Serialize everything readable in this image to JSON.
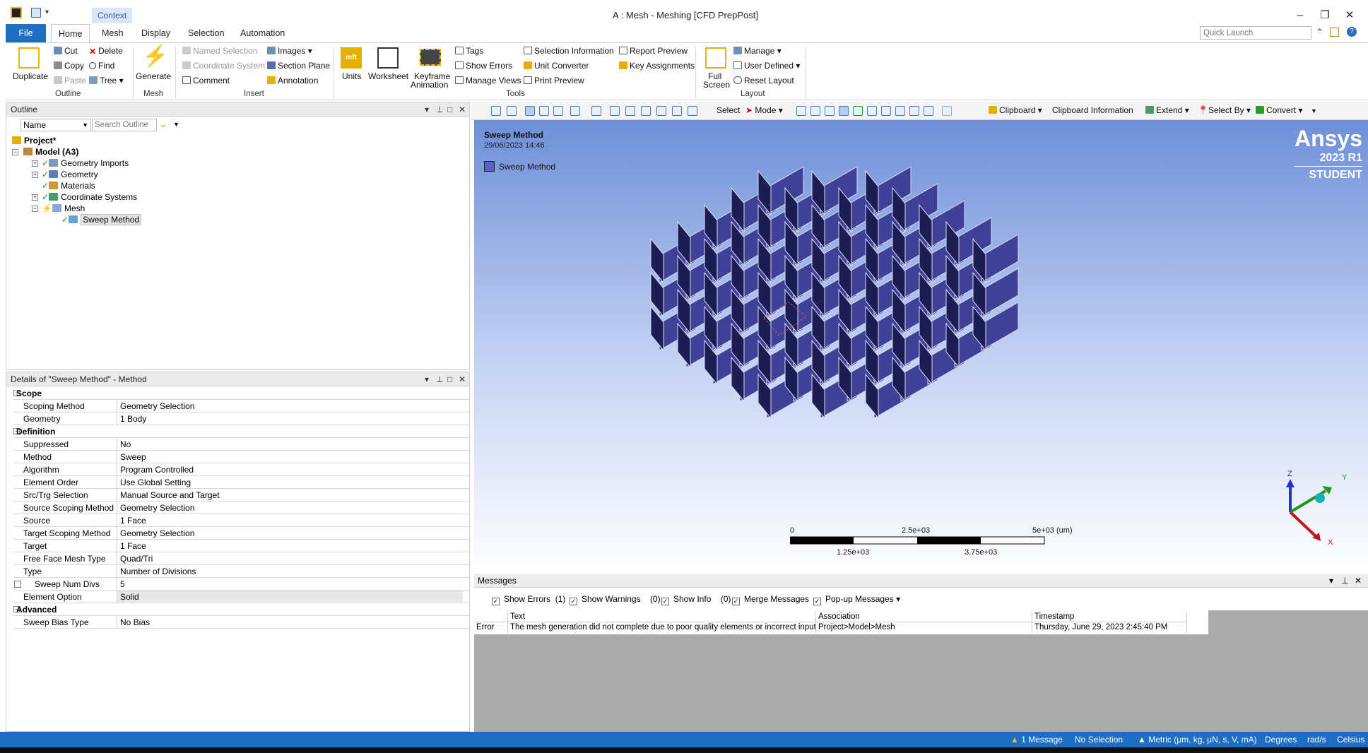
{
  "window": {
    "title": "A : Mesh - Meshing [CFD PrepPost]",
    "context_tab": "Context",
    "quick_launch_placeholder": "Quick Launch"
  },
  "ribbon_tabs": [
    "File",
    "Home",
    "Mesh",
    "Display",
    "Selection",
    "Automation"
  ],
  "ribbon": {
    "outline": {
      "group": "Outline",
      "duplicate": "Duplicate",
      "cut": "Cut",
      "copy": "Copy",
      "paste": "Paste",
      "delete": "Delete",
      "find": "Find",
      "tree": "Tree"
    },
    "mesh": {
      "group": "Mesh",
      "generate": "Generate"
    },
    "insert": {
      "group": "Insert",
      "named_selection": "Named Selection",
      "coordinate_system": "Coordinate System",
      "comment": "Comment",
      "images": "Images",
      "section_plane": "Section Plane",
      "annotation": "Annotation"
    },
    "tools": {
      "group": "Tools",
      "units": "Units",
      "worksheet": "Worksheet",
      "keyframe_1": "Keyframe",
      "keyframe_2": "Animation",
      "tags": "Tags",
      "show_errors": "Show Errors",
      "manage_views": "Manage Views",
      "selection_information": "Selection Information",
      "unit_converter": "Unit Converter",
      "print_preview": "Print Preview",
      "report_preview": "Report Preview",
      "key_assignments": "Key Assignments"
    },
    "layout": {
      "group": "Layout",
      "full_1": "Full",
      "full_2": "Screen",
      "manage": "Manage",
      "user_defined": "User Defined",
      "reset_layout": "Reset Layout"
    }
  },
  "outline": {
    "title": "Outline",
    "name_dropdown": "Name",
    "search_placeholder": "Search Outline",
    "tree": {
      "project": "Project*",
      "model": "Model (A3)",
      "geometry_imports": "Geometry Imports",
      "geometry": "Geometry",
      "materials": "Materials",
      "coordinate_systems": "Coordinate Systems",
      "mesh": "Mesh",
      "sweep_method": "Sweep Method"
    }
  },
  "details": {
    "title": "Details of \"Sweep Method\" - Method",
    "rows": [
      {
        "k": "Scope",
        "cat": true
      },
      {
        "k": "Scoping Method",
        "v": "Geometry Selection"
      },
      {
        "k": "Geometry",
        "v": "1 Body"
      },
      {
        "k": "Definition",
        "cat": true
      },
      {
        "k": "Suppressed",
        "v": "No"
      },
      {
        "k": "Method",
        "v": "Sweep"
      },
      {
        "k": "Algorithm",
        "v": "Program Controlled"
      },
      {
        "k": "Element Order",
        "v": "Use Global Setting"
      },
      {
        "k": "Src/Trg Selection",
        "v": "Manual Source and Target"
      },
      {
        "k": "Source Scoping Method",
        "v": "Geometry Selection"
      },
      {
        "k": "Source",
        "v": "1 Face"
      },
      {
        "k": "Target Scoping Method",
        "v": "Geometry Selection"
      },
      {
        "k": "Target",
        "v": "1 Face"
      },
      {
        "k": "Free Face Mesh Type",
        "v": "Quad/Tri"
      },
      {
        "k": "Type",
        "v": "Number of Divisions"
      },
      {
        "k": "Sweep Num Divs",
        "v": "5",
        "check": true
      },
      {
        "k": "Element Option",
        "v": "Solid",
        "hl": true
      },
      {
        "k": "Advanced",
        "cat": true
      },
      {
        "k": "Sweep Bias Type",
        "v": "No Bias"
      }
    ]
  },
  "viewport_toolbar": {
    "select": "Select",
    "mode": "Mode",
    "clipboard": "Clipboard",
    "clipboard_information": "Clipboard Information",
    "extend": "Extend",
    "select_by": "Select By",
    "convert": "Convert"
  },
  "viewport": {
    "title": "Sweep Method",
    "date": "29/06/2023 14:46",
    "legend": "Sweep Method",
    "brand": "Ansys",
    "version": "2023 R1",
    "edition": "STUDENT",
    "scale": {
      "l0": "0",
      "l1": "2.5e+03",
      "l2": "5e+03 (um)",
      "l3": "1.25e+03",
      "l4": "3.75e+03"
    },
    "axes": {
      "z": "Z",
      "y": "Y",
      "x": "X"
    },
    "colors": {
      "face": "#3d3f8f",
      "edge": "#1c1d52"
    }
  },
  "messages": {
    "title": "Messages",
    "show_errors": "Show Errors",
    "errors_count": "(1)",
    "show_warnings": "Show Warnings",
    "warnings_count": "(0)",
    "show_info": "Show Info",
    "info_count": "(0)",
    "merge_messages": "Merge Messages",
    "popup_messages": "Pop-up Messages",
    "col_text": "Text",
    "col_association": "Association",
    "col_timestamp": "Timestamp",
    "row": {
      "type": "Error",
      "text": "The mesh generation did not complete due to poor quality elements or incorrect input. P",
      "association": "Project>Model>Mesh",
      "timestamp": "Thursday, June 29, 2023 2:45:40 PM"
    }
  },
  "status": {
    "messages": "1 Message",
    "selection": "No Selection",
    "units": "Metric (μm, kg, μN, s, V, mA)",
    "degrees": "Degrees",
    "rads": "rad/s",
    "temp": "Celsius"
  }
}
